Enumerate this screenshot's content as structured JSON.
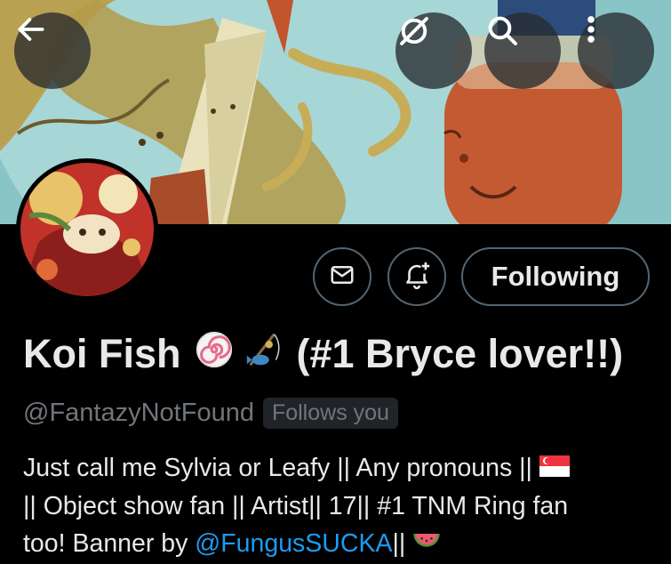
{
  "header": {
    "back_icon": "arrow-left-icon",
    "grok_icon": "grok-icon",
    "search_icon": "search-icon",
    "more_icon": "more-vertical-icon"
  },
  "actions": {
    "message_icon": "envelope-icon",
    "notify_icon": "bell-plus-icon",
    "following_label": "Following"
  },
  "profile": {
    "name_main": "Koi Fish",
    "name_suffix": "(#1 Bryce lover!!)",
    "name_emojis": [
      "narutomaki",
      "fishing-pole"
    ],
    "handle": "@FantazyNotFound",
    "follows_you": "Follows you",
    "bio": {
      "line1": "Just call me Sylvia or Leafy || Any pronouns || ",
      "line2": "|| Object show fan || Artist|| 17|| #1 TNM Ring fan",
      "line3_prefix": "too!  Banner by ",
      "line3_link": "@FungusSUCKA",
      "line3_suffix": "|| ",
      "emojis": [
        "singapore-flag",
        "watermelon"
      ]
    }
  },
  "colors": {
    "background": "#000000",
    "link": "#1d9bf0",
    "muted": "#71767b",
    "border": "#536471",
    "text": "#e7e9ea"
  }
}
